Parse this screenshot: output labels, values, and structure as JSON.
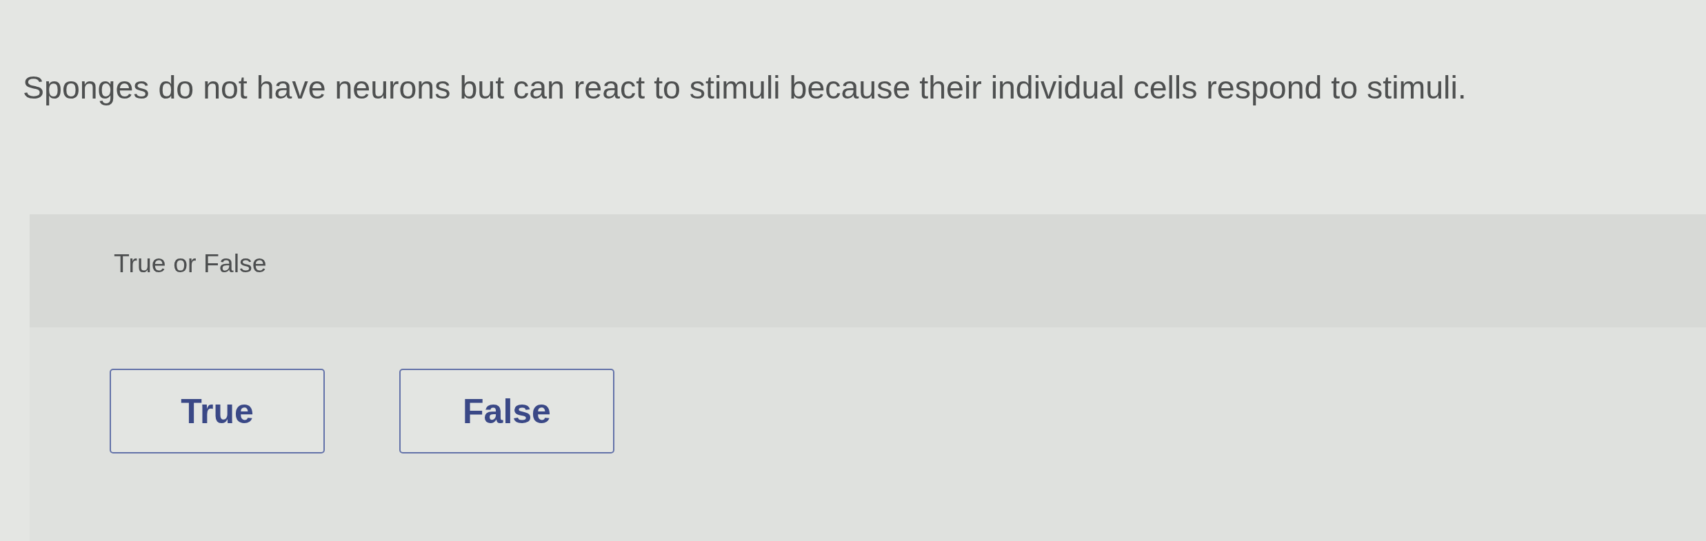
{
  "question": {
    "text": "Sponges do not have neurons but can react to stimuli because their individual cells respond to stimuli."
  },
  "answer_panel": {
    "prompt": "True or False",
    "options": [
      {
        "label": "True",
        "selected": false
      },
      {
        "label": "False",
        "selected": false
      }
    ]
  }
}
